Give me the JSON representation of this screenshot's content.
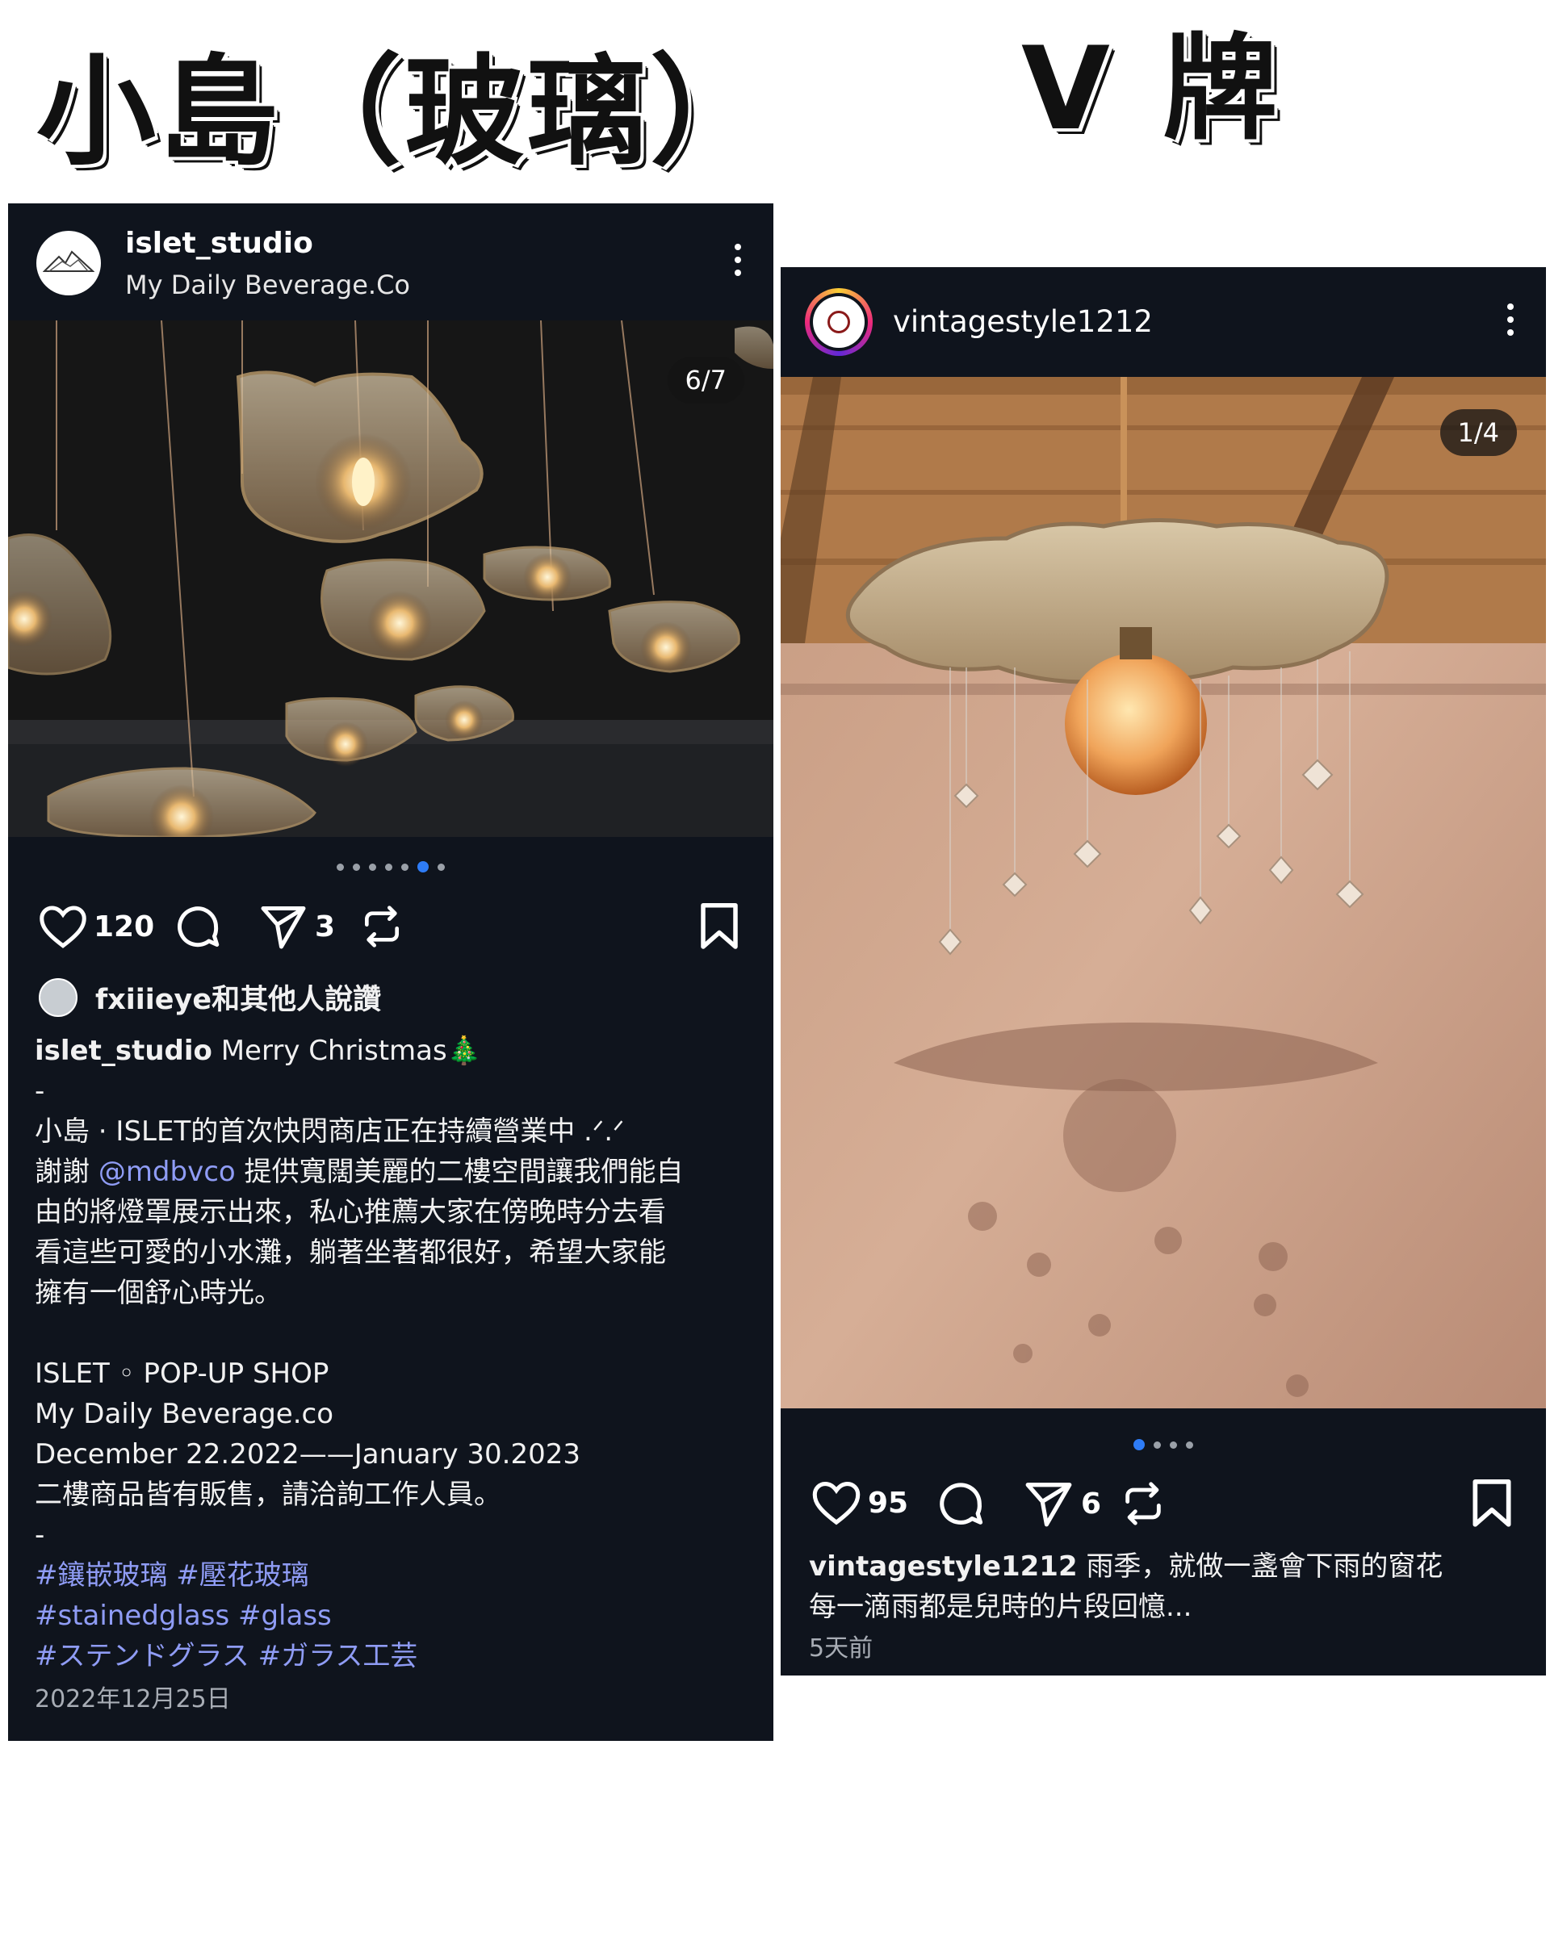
{
  "titles": {
    "left": "小島（玻璃）",
    "right": "V 牌"
  },
  "left_post": {
    "username": "islet_studio",
    "subtitle": "My Daily Beverage.Co",
    "counter": "6/7",
    "carousel": {
      "count": 7,
      "active": 5
    },
    "likes": "120",
    "shares": "3",
    "liked_by": "fxiiieye和其他人說讚",
    "caption_user": "islet_studio",
    "caption_text": "Merry Christmas🎄",
    "dash1": "-",
    "para1_line1": "小島 · ISLET的首次快閃商店正在持續營業中 .ᐟ.ᐟ",
    "para1_line2_prefix": "謝謝 ",
    "mention": "@mdbvco",
    "para1_line2_suffix": " 提供寬闊美麗的二樓空間讓我們能自",
    "para1_line3": "由的將燈罩展示出來，私心推薦大家在傍晚時分去看",
    "para1_line4": "看這些可愛的小水灘，躺著坐著都很好，希望大家能",
    "para1_line5": "擁有一個舒心時光。",
    "shop_line1": "ISLET ◦ POP-UP SHOP",
    "shop_line2": "My Daily Beverage.co",
    "shop_line3": "December 22.2022——January 30.2023",
    "shop_line4": "二樓商品皆有販售，請洽詢工作人員。",
    "dash2": "-",
    "tags_line1": "#鑲嵌玻璃 #壓花玻璃",
    "tags_line2": "#stainedglass #glass",
    "tags_line3": "#ステンドグラス #ガラス工芸",
    "date": "2022年12月25日"
  },
  "right_post": {
    "username": "vintagestyle1212",
    "counter": "1/4",
    "carousel": {
      "count": 4,
      "active": 0
    },
    "likes": "95",
    "shares": "6",
    "caption_user": "vintagestyle1212",
    "caption_line1": "雨季，就做一盞會下雨的窗花",
    "caption_line2": "每一滴雨都是兒時的片段回憶...",
    "time": "5天前"
  },
  "icons": [
    "heart-icon",
    "comment-icon",
    "send-icon",
    "repost-icon",
    "bookmark-icon",
    "more-icon"
  ],
  "colors": {
    "post_bg": "#0f141d",
    "hashtag": "#8f9cf5",
    "active_dot": "#2e7cf6"
  }
}
